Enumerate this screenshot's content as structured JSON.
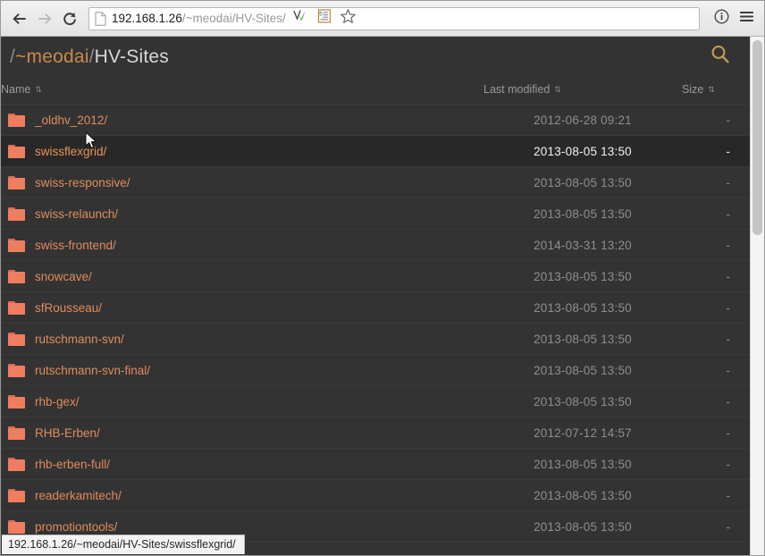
{
  "browser": {
    "back_label": "Back",
    "forward_label": "Forward",
    "reload_label": "Reload",
    "url_host": "192.168.1.26",
    "url_path": "/~meodai/HV-Sites/",
    "page_icon": "page-icon",
    "back_icon": "arrow-left-icon",
    "forward_icon": "arrow-right-icon",
    "reload_icon": "reload-icon",
    "extension_icon": "checkmark-extension-icon",
    "reader_icon": "reader-list-icon",
    "bookmark_icon": "star-icon",
    "info_icon": "info-circle-icon",
    "menu_icon": "hamburger-menu-icon"
  },
  "listing": {
    "breadcrumb": {
      "root_sep": "/",
      "user": "~meodai",
      "mid_sep": "/",
      "dir": "HV-Sites"
    },
    "search_icon": "search-icon",
    "columns": {
      "name": "Name",
      "modified": "Last modified",
      "size": "Size",
      "sort_glyph": "⇅"
    },
    "rows": [
      {
        "name": "_oldhv_2012/",
        "modified": "2012-06-28 09:21",
        "size": "-",
        "hovered": false
      },
      {
        "name": "swissflexgrid/",
        "modified": "2013-08-05 13:50",
        "size": "-",
        "hovered": true
      },
      {
        "name": "swiss-responsive/",
        "modified": "2013-08-05 13:50",
        "size": "-",
        "hovered": false
      },
      {
        "name": "swiss-relaunch/",
        "modified": "2013-08-05 13:50",
        "size": "-",
        "hovered": false
      },
      {
        "name": "swiss-frontend/",
        "modified": "2014-03-31 13:20",
        "size": "-",
        "hovered": false
      },
      {
        "name": "snowcave/",
        "modified": "2013-08-05 13:50",
        "size": "-",
        "hovered": false
      },
      {
        "name": "sfRousseau/",
        "modified": "2013-08-05 13:50",
        "size": "-",
        "hovered": false
      },
      {
        "name": "rutschmann-svn/",
        "modified": "2013-08-05 13:50",
        "size": "-",
        "hovered": false
      },
      {
        "name": "rutschmann-svn-final/",
        "modified": "2013-08-05 13:50",
        "size": "-",
        "hovered": false
      },
      {
        "name": "rhb-gex/",
        "modified": "2013-08-05 13:50",
        "size": "-",
        "hovered": false
      },
      {
        "name": "RHB-Erben/",
        "modified": "2012-07-12 14:57",
        "size": "-",
        "hovered": false
      },
      {
        "name": "rhb-erben-full/",
        "modified": "2013-08-05 13:50",
        "size": "-",
        "hovered": false
      },
      {
        "name": "readerkamitech/",
        "modified": "2013-08-05 13:50",
        "size": "-",
        "hovered": false
      },
      {
        "name": "promotiontools/",
        "modified": "2013-08-05 13:50",
        "size": "-",
        "hovered": false
      }
    ],
    "folder_icon": "folder-icon"
  },
  "statusbar": {
    "text": "192.168.1.26/~meodai/HV-Sites/swissflexgrid/"
  },
  "colors": {
    "background": "#333333",
    "row_hover": "#282828",
    "folder": "#ef7d60",
    "link": "#e08b5d",
    "accent_breadcrumb": "#c98a4b",
    "search": "#c09a58",
    "muted_text": "#8e8e8e"
  }
}
